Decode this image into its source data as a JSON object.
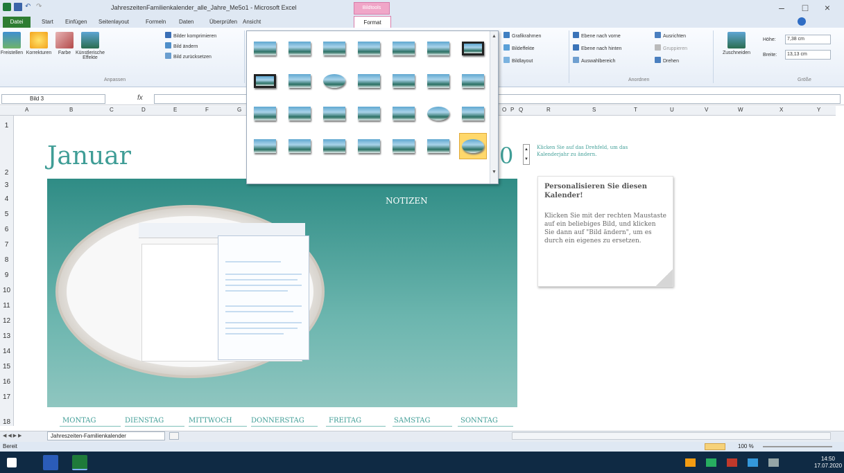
{
  "window": {
    "title": "JahreszeitenFamilienkalender_alle_Jahre_Me5o1 - Microsoft Excel",
    "context_tab_group": "Bildtools",
    "minimize": "–",
    "maximize": "□",
    "close": "×"
  },
  "ribbon_tabs": [
    "Datei",
    "Start",
    "Einfügen",
    "Seitenlayout",
    "Formeln",
    "Daten",
    "Überprüfen",
    "Ansicht",
    "Format"
  ],
  "ribbon": {
    "freistellen": "Freistellen",
    "korrekturen": "Korrekturen",
    "farbe": "Farbe",
    "kuenstlerische_effekte": "Künstlerische Effekte",
    "bilder_komprimieren": "Bilder komprimieren",
    "bild_aendern": "Bild ändern",
    "bild_zuruecksetzen": "Bild zurücksetzen",
    "anpassen": "Anpassen",
    "grafikrahmen": "Grafikrahmen",
    "bildeffekte": "Bildeffekte",
    "bildlayout": "Bildlayout",
    "ebene_nach_vorne": "Ebene nach vorne",
    "ebene_nach_hinten": "Ebene nach hinten",
    "auswahlbereich": "Auswahlbereich",
    "ausrichten": "Ausrichten",
    "gruppieren": "Gruppieren",
    "drehen": "Drehen",
    "anordnen": "Anordnen",
    "zuschneiden": "Zuschneiden",
    "hoehe_label": "Höhe:",
    "hoehe_value": "7,38 cm",
    "breite_label": "Breite:",
    "breite_value": "13,13 cm",
    "groesse": "Größe"
  },
  "formula_bar": {
    "name_box": "Bild 3",
    "fx": "fx",
    "content": ""
  },
  "columns": [
    "A",
    "B",
    "C",
    "D",
    "E",
    "F",
    "G",
    "O",
    "P",
    "Q",
    "R",
    "S",
    "T",
    "U",
    "V",
    "W",
    "X",
    "Y"
  ],
  "rows": [
    "1",
    "2",
    "3",
    "4",
    "5",
    "6",
    "7",
    "8",
    "9",
    "10",
    "11",
    "12",
    "13",
    "14",
    "15",
    "16",
    "17",
    "18"
  ],
  "sheet": {
    "month": "Januar",
    "year_digit": "0",
    "hint": "Klicken Sie auf das Drehfeld, um das Kalenderjahr zu ändern.",
    "notes_label": "NOTIZEN",
    "card_title": "Personalisieren Sie diesen Kalender!",
    "card_text": "Klicken Sie mit der rechten Maustaste auf ein beliebiges Bild, und klicken Sie dann auf \"Bild ändern\", um es durch ein eigenes zu ersetzen.",
    "days": [
      "MONTAG",
      "DIENSTAG",
      "MITTWOCH",
      "DONNERSTAG",
      "FREITAG",
      "SAMSTAG",
      "SONNTAG"
    ]
  },
  "gallery": {
    "item_count": 28,
    "selected_index": 27
  },
  "sheet_tab": "Jahreszeiten-Familienkalender",
  "status": {
    "left": "Bereit",
    "zoom": "100 %"
  },
  "clock": {
    "time": "14:50",
    "date": "17.07.2020"
  },
  "colors": {
    "accent": "#3f9d96",
    "format_tab_pink": "#f0a6c8"
  }
}
